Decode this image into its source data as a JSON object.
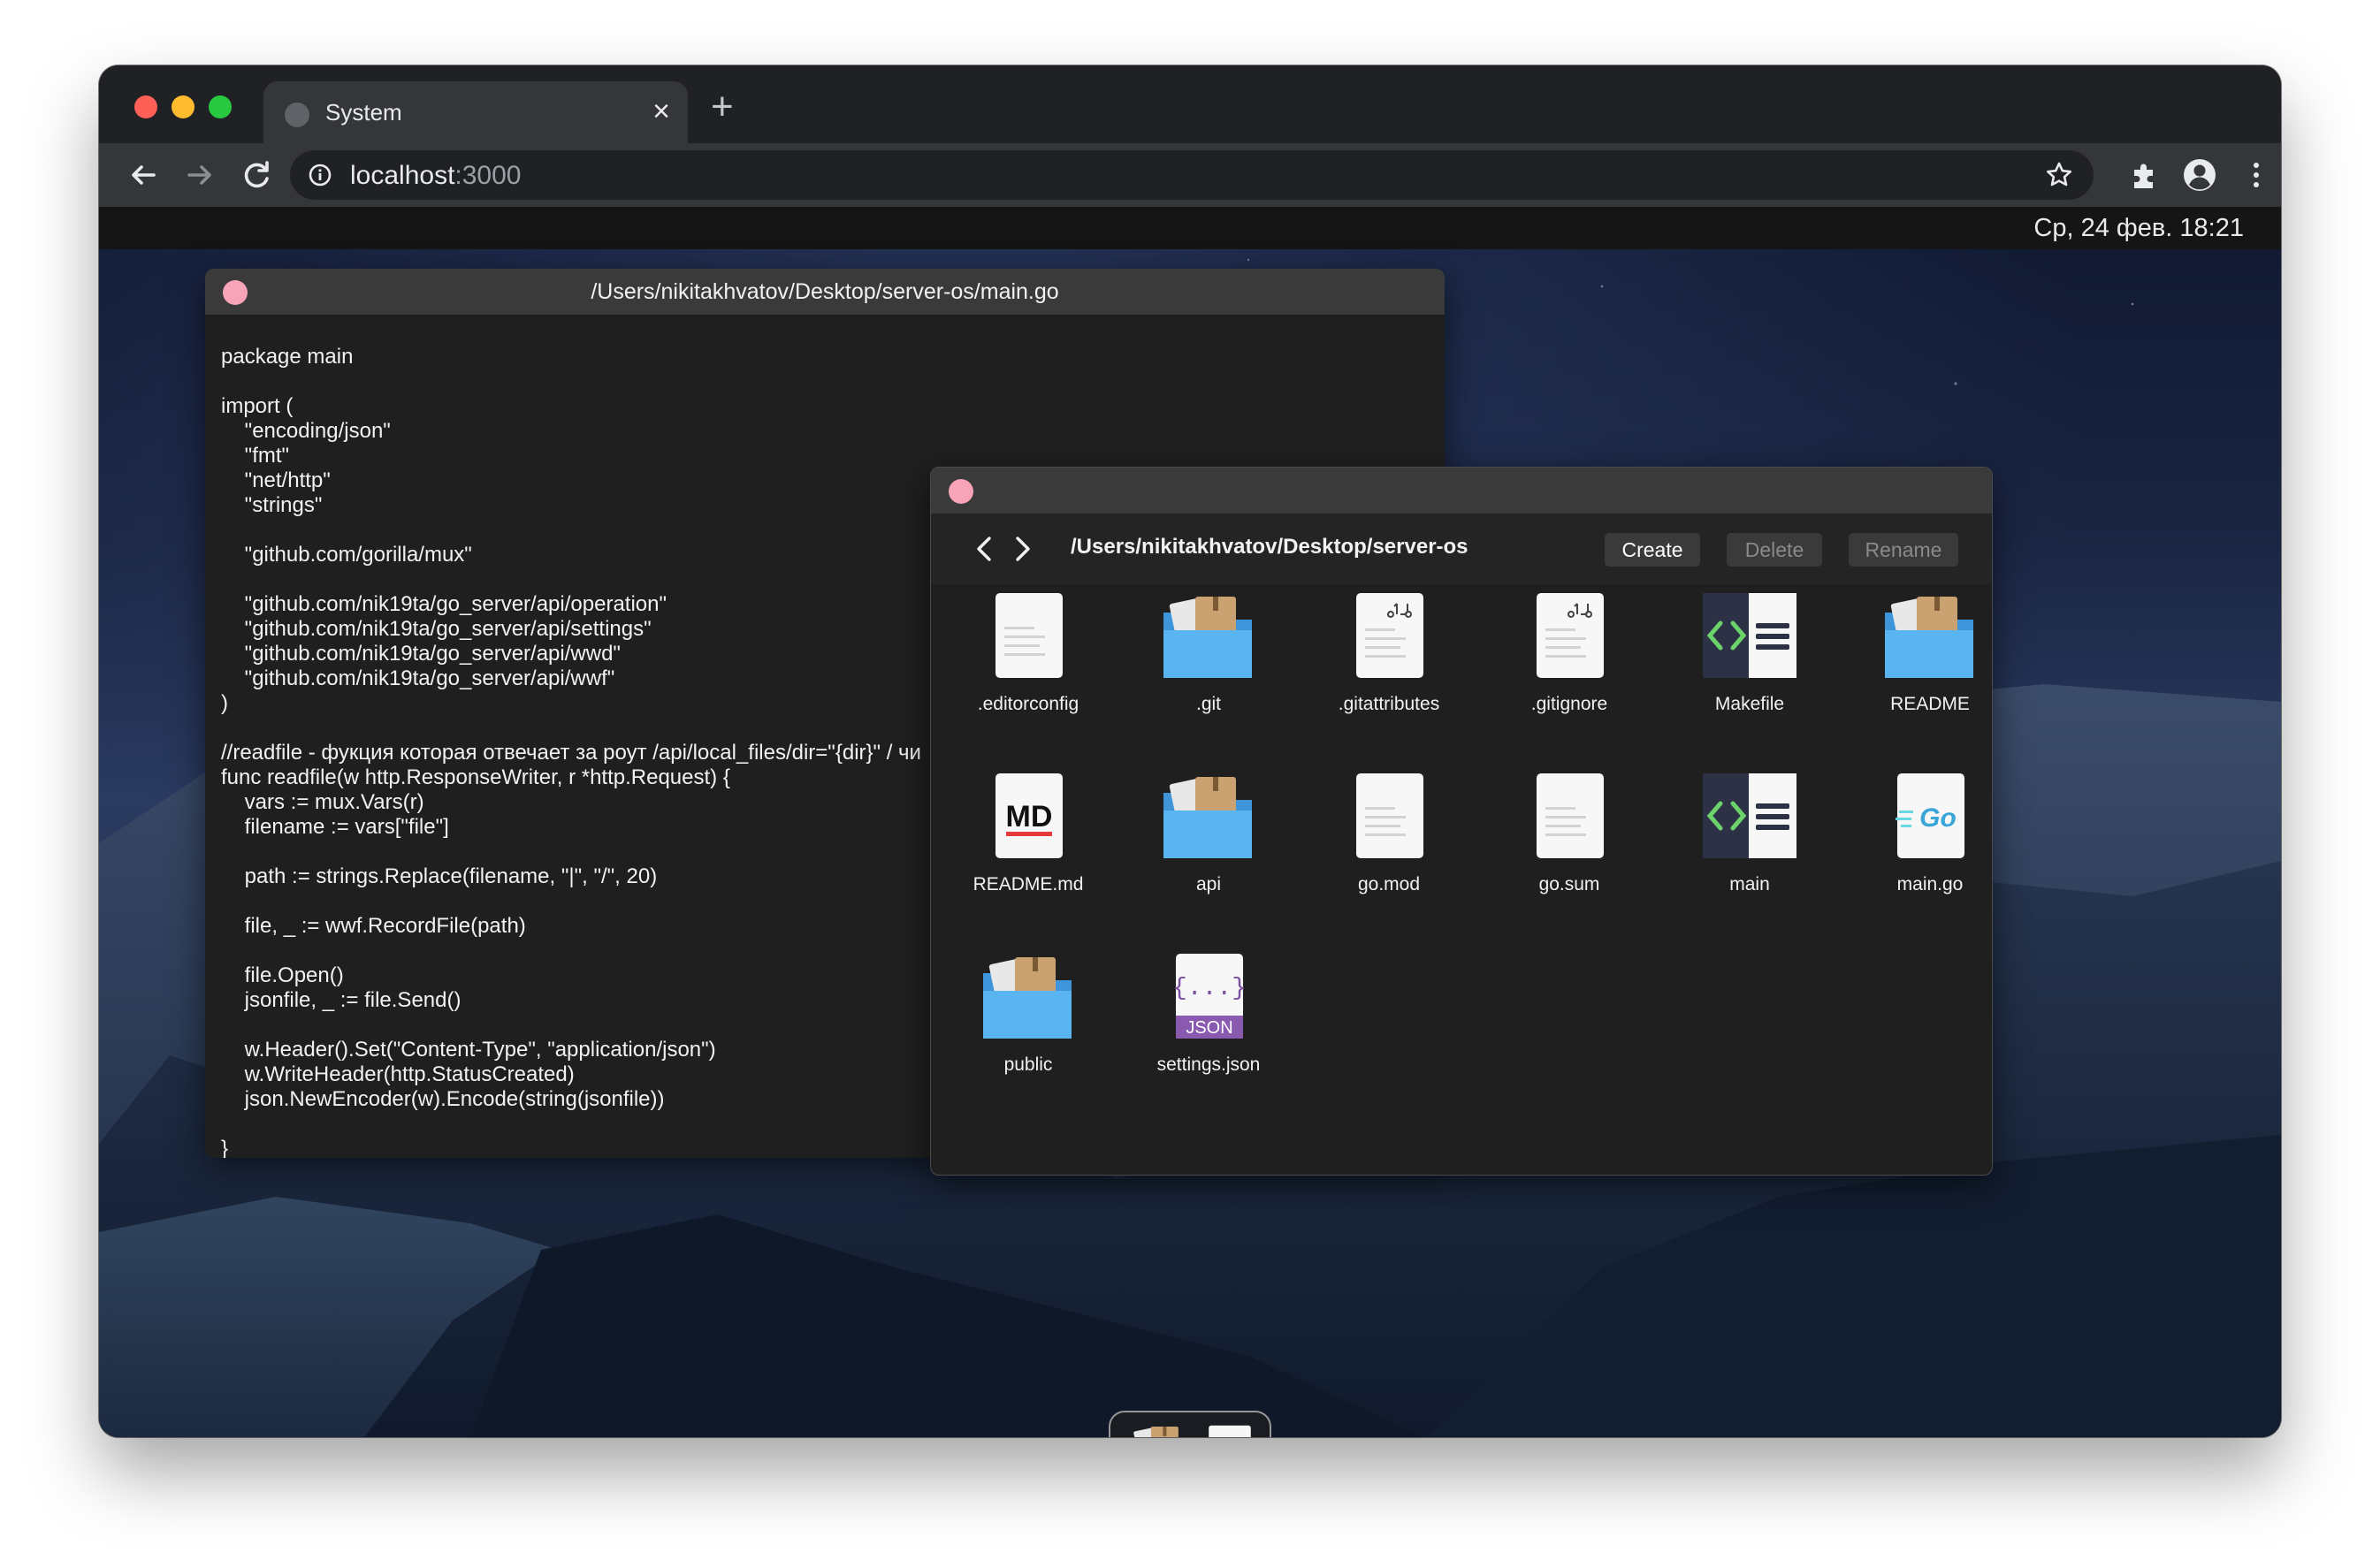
{
  "browser": {
    "tab_title": "System",
    "tab_close": "×",
    "new_tab": "+",
    "url_host": "localhost",
    "url_port": ":3000"
  },
  "desktop": {
    "clock": "Ср, 24 фев. 18:21"
  },
  "editor": {
    "title": "/Users/nikitakhvatov/Desktop/server-os/main.go",
    "code": "package main\n\nimport (\n\t\"encoding/json\"\n\t\"fmt\"\n\t\"net/http\"\n\t\"strings\"\n\n\t\"github.com/gorilla/mux\"\n\n\t\"github.com/nik19ta/go_server/api/operation\"\n\t\"github.com/nik19ta/go_server/api/settings\"\n\t\"github.com/nik19ta/go_server/api/wwd\"\n\t\"github.com/nik19ta/go_server/api/wwf\"\n)\n\n//readfile - фукция которая отвечает за роут /api/local_files/dir=\"{dir}\" / чи\nfunc readfile(w http.ResponseWriter, r *http.Request) {\n\tvars := mux.Vars(r)\n\tfilename := vars[\"file\"]\n\n\tpath := strings.Replace(filename, \"|\", \"/\", 20)\n\n\tfile, _ := wwf.RecordFile(path)\n\n\tfile.Open()\n\tjsonfile, _ := file.Send()\n\n\tw.Header().Set(\"Content-Type\", \"application/json\")\n\tw.WriteHeader(http.StatusCreated)\n\tjson.NewEncoder(w).Encode(string(jsonfile))\n\n}"
  },
  "finder": {
    "path": "/Users/nikitakhvatov/Desktop/server-os",
    "create_label": "Create",
    "delete_label": "Delete",
    "rename_label": "Rename",
    "items": [
      {
        "name": ".editorconfig",
        "icon": "document-icon"
      },
      {
        "name": ".git",
        "icon": "folder-icon"
      },
      {
        "name": ".gitattributes",
        "icon": "git-document-icon"
      },
      {
        "name": ".gitignore",
        "icon": "git-document-icon"
      },
      {
        "name": "Makefile",
        "icon": "code-file-icon"
      },
      {
        "name": "README",
        "icon": "folder-icon"
      },
      {
        "name": "README.md",
        "icon": "markdown-icon"
      },
      {
        "name": "api",
        "icon": "folder-icon"
      },
      {
        "name": "go.mod",
        "icon": "document-icon"
      },
      {
        "name": "go.sum",
        "icon": "document-icon"
      },
      {
        "name": "main",
        "icon": "code-file-icon"
      },
      {
        "name": "main.go",
        "icon": "go-file-icon"
      },
      {
        "name": "public",
        "icon": "folder-icon"
      },
      {
        "name": "settings.json",
        "icon": "json-file-icon"
      }
    ],
    "md_badge": "MD",
    "go_badge": "Go",
    "json_badge": "JSON",
    "json_braces": "{...}"
  },
  "colors": {
    "traffic_red": "#fe5f57",
    "traffic_yellow": "#febc2e",
    "traffic_green": "#28c840",
    "window_dot": "#f7a3b8",
    "folder_blue": "#5ab4f0"
  }
}
